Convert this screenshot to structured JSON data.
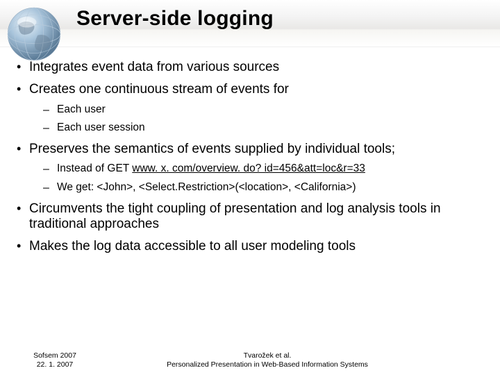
{
  "title": "Server-side logging",
  "bullets": {
    "b1": "Integrates event data from various sources",
    "b2": "Creates one continuous stream of events for",
    "b2_sub": {
      "s1": "Each user",
      "s2": "Each user session"
    },
    "b3": "Preserves the semantics of events supplied by individual tools;",
    "b3_sub": {
      "s1_prefix": "Instead of GET ",
      "s1_link": "www. x. com/overview. do? id=456&att=loc&r=33",
      "s2": "We get: <John>, <Select.Restriction>(<location>, <California>)"
    },
    "b4": "Circumvents the tight coupling of presentation and log analysis tools in traditional approaches",
    "b5": "Makes the log data accessible to all user modeling tools"
  },
  "footer": {
    "left_line1": "Sofsem 2007",
    "left_line2": "22. 1. 2007",
    "center_line1": "Tvarožek et al.",
    "center_line2": "Personalized Presentation in Web-Based Information Systems"
  }
}
